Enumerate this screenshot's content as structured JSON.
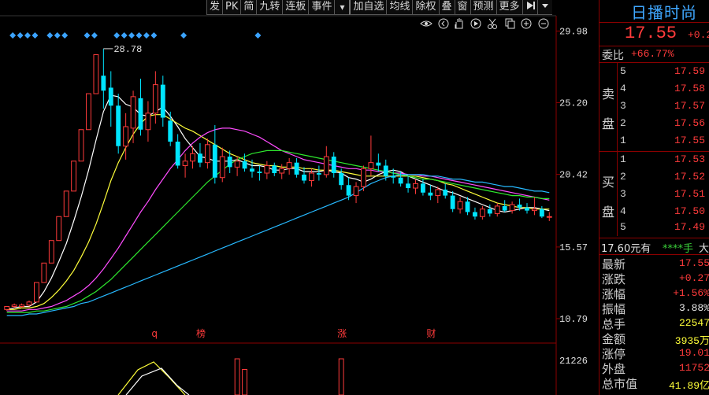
{
  "toolbar": {
    "items": [
      "发",
      "PK",
      "简",
      "九转",
      "连板",
      "事件",
      "▾",
      "加自选",
      "均线",
      "除权",
      "叠",
      "窗",
      "预测",
      "更多"
    ],
    "arrow_icon": "play-arrow-icon",
    "dropdown_icon": "chevron-down-icon"
  },
  "chart_icons": [
    "eye-icon",
    "chevron-left-circle-icon",
    "hand-icon",
    "play-circle-icon",
    "scissors-icon",
    "copy-icon",
    "zoom-in-icon",
    "zoom-out-icon"
  ],
  "price_axis": [
    "29.98",
    "25.20",
    "20.42",
    "15.57",
    "10.79"
  ],
  "volume_axis": [
    "21226"
  ],
  "high_annotation": "28.78",
  "event_markers": [
    {
      "label": "q",
      "bar": 20
    },
    {
      "label": "榜",
      "bar": 26
    },
    {
      "label": "涨",
      "bar": 45
    },
    {
      "label": "财",
      "bar": 57
    }
  ],
  "colors": {
    "up": "#ff3b3b",
    "down": "#00e5ff",
    "ma5": "#ffffff",
    "ma10": "#ffff3a",
    "ma20": "#ff4cff",
    "ma30": "#2ee82e",
    "ma60": "#27b9ff",
    "axis": "#8b0000",
    "diamond": "#3ba3ff"
  },
  "chart_data": {
    "type": "candlestick",
    "ylim": [
      10.0,
      31.0
    ],
    "candles": [
      [
        11.4,
        11.6,
        11.3,
        11.6
      ],
      [
        11.6,
        11.8,
        11.5,
        11.7
      ],
      [
        11.6,
        11.8,
        11.5,
        11.7
      ],
      [
        11.7,
        12.0,
        11.6,
        11.9
      ],
      [
        11.9,
        13.2,
        11.9,
        13.2
      ],
      [
        13.2,
        14.5,
        13.2,
        14.5
      ],
      [
        14.5,
        16.0,
        14.5,
        16.0
      ],
      [
        16.0,
        17.6,
        16.0,
        17.6
      ],
      [
        17.6,
        19.3,
        17.6,
        19.3
      ],
      [
        19.3,
        21.3,
        19.3,
        21.3
      ],
      [
        21.3,
        23.4,
        21.3,
        23.4
      ],
      [
        23.4,
        25.8,
        23.4,
        25.8
      ],
      [
        25.8,
        28.4,
        25.8,
        28.4
      ],
      [
        27.0,
        28.8,
        24.8,
        26.0
      ],
      [
        26.2,
        27.3,
        23.6,
        25.0
      ],
      [
        25.0,
        25.8,
        21.8,
        22.3
      ],
      [
        22.3,
        24.5,
        21.4,
        23.6
      ],
      [
        23.5,
        26.0,
        22.5,
        25.6
      ],
      [
        25.5,
        26.8,
        23.0,
        23.4
      ],
      [
        23.4,
        25.3,
        22.6,
        24.5
      ],
      [
        24.5,
        27.3,
        23.8,
        26.4
      ],
      [
        26.4,
        27.0,
        23.6,
        24.2
      ],
      [
        24.0,
        24.6,
        22.3,
        22.6
      ],
      [
        22.6,
        23.1,
        20.8,
        21.0
      ],
      [
        21.0,
        21.8,
        20.2,
        21.3
      ],
      [
        21.3,
        22.3,
        20.8,
        21.8
      ],
      [
        21.8,
        22.5,
        20.9,
        21.2
      ],
      [
        21.2,
        22.8,
        20.8,
        22.4
      ],
      [
        22.4,
        23.7,
        19.8,
        20.2
      ],
      [
        20.2,
        22.2,
        19.9,
        21.6
      ],
      [
        21.6,
        22.0,
        20.5,
        20.9
      ],
      [
        20.9,
        21.6,
        20.3,
        21.3
      ],
      [
        21.3,
        21.8,
        20.6,
        20.8
      ],
      [
        20.8,
        21.4,
        20.2,
        20.6
      ],
      [
        20.6,
        21.0,
        20.0,
        20.5
      ],
      [
        20.5,
        21.3,
        20.1,
        21.0
      ],
      [
        21.0,
        21.2,
        20.3,
        20.5
      ],
      [
        20.5,
        21.1,
        20.1,
        20.8
      ],
      [
        20.8,
        21.5,
        20.4,
        21.2
      ],
      [
        21.2,
        21.5,
        20.2,
        20.4
      ],
      [
        20.4,
        20.9,
        19.8,
        20.0
      ],
      [
        20.0,
        20.8,
        19.6,
        20.5
      ],
      [
        20.5,
        21.0,
        20.0,
        20.4
      ],
      [
        20.4,
        22.3,
        20.2,
        21.6
      ],
      [
        21.6,
        21.9,
        20.2,
        20.5
      ],
      [
        20.5,
        20.8,
        19.4,
        19.7
      ],
      [
        19.7,
        20.2,
        18.7,
        19.0
      ],
      [
        19.0,
        19.9,
        18.5,
        19.6
      ],
      [
        19.6,
        21.0,
        19.3,
        20.8
      ],
      [
        20.8,
        23.0,
        20.3,
        21.2
      ],
      [
        21.2,
        21.8,
        20.6,
        21.0
      ],
      [
        21.0,
        21.4,
        20.0,
        20.3
      ],
      [
        20.3,
        20.8,
        19.8,
        20.2
      ],
      [
        20.2,
        20.6,
        19.6,
        19.8
      ],
      [
        19.8,
        20.3,
        19.2,
        19.5
      ],
      [
        19.5,
        20.1,
        19.1,
        19.8
      ],
      [
        19.8,
        20.1,
        19.0,
        19.2
      ],
      [
        19.2,
        19.7,
        18.7,
        19.0
      ],
      [
        19.0,
        19.6,
        18.5,
        19.4
      ],
      [
        19.4,
        19.8,
        18.8,
        19.0
      ],
      [
        19.0,
        19.3,
        17.9,
        18.1
      ],
      [
        18.1,
        18.9,
        17.8,
        18.6
      ],
      [
        18.6,
        18.9,
        17.7,
        17.9
      ],
      [
        17.9,
        18.2,
        17.4,
        17.6
      ],
      [
        17.6,
        18.3,
        17.4,
        18.1
      ],
      [
        18.1,
        18.4,
        17.6,
        17.8
      ],
      [
        17.8,
        18.5,
        17.6,
        18.3
      ],
      [
        18.3,
        18.7,
        17.9,
        18.0
      ],
      [
        18.0,
        18.6,
        17.8,
        18.4
      ],
      [
        18.4,
        18.8,
        18.0,
        18.2
      ],
      [
        18.2,
        18.5,
        17.8,
        18.0
      ],
      [
        18.0,
        18.9,
        17.7,
        18.1
      ],
      [
        18.1,
        18.3,
        17.5,
        17.6
      ],
      [
        17.6,
        17.9,
        17.3,
        17.6
      ]
    ],
    "ma": {
      "ma5": [
        11.4,
        11.5,
        11.6,
        11.6,
        11.9,
        12.6,
        13.5,
        14.6,
        15.8,
        17.3,
        18.9,
        20.7,
        22.7,
        24.6,
        25.7,
        25.6,
        25.1,
        24.9,
        24.4,
        24.3,
        24.6,
        24.9,
        24.3,
        23.6,
        22.8,
        22.2,
        21.6,
        21.5,
        21.3,
        21.3,
        21.3,
        21.4,
        21.2,
        21.0,
        21.0,
        20.9,
        20.7,
        20.7,
        20.8,
        20.8,
        20.6,
        20.6,
        20.6,
        20.7,
        20.6,
        20.5,
        20.2,
        20.1,
        19.9,
        20.1,
        20.4,
        20.6,
        20.7,
        20.6,
        20.3,
        20.1,
        19.9,
        19.7,
        19.5,
        19.3,
        19.2,
        19.0,
        18.8,
        18.6,
        18.4,
        18.2,
        18.0,
        17.9,
        18.0,
        18.1,
        18.2,
        18.2,
        18.1,
        18.0
      ],
      "ma10": [
        11.4,
        11.4,
        11.5,
        11.5,
        11.6,
        11.8,
        12.2,
        12.7,
        13.3,
        14.0,
        14.9,
        15.9,
        17.1,
        18.5,
        20.0,
        21.2,
        22.2,
        23.1,
        23.8,
        24.3,
        24.4,
        24.4,
        24.1,
        23.8,
        23.5,
        23.3,
        23.0,
        22.7,
        22.4,
        22.1,
        21.8,
        21.6,
        21.4,
        21.2,
        21.1,
        21.0,
        21.0,
        20.9,
        20.9,
        20.9,
        20.8,
        20.8,
        20.7,
        20.7,
        20.7,
        20.6,
        20.5,
        20.4,
        20.3,
        20.3,
        20.3,
        20.3,
        20.3,
        20.3,
        20.3,
        20.3,
        20.2,
        20.1,
        20.0,
        19.8,
        19.7,
        19.5,
        19.3,
        19.1,
        18.9,
        18.7,
        18.5,
        18.4,
        18.3,
        18.2,
        18.2,
        18.1,
        18.1,
        18.1
      ],
      "ma20": [
        11.3,
        11.3,
        11.3,
        11.4,
        11.4,
        11.5,
        11.6,
        11.8,
        12.0,
        12.3,
        12.6,
        13.0,
        13.5,
        14.1,
        14.8,
        15.5,
        16.3,
        17.1,
        17.9,
        18.6,
        19.4,
        20.1,
        20.8,
        21.4,
        22.0,
        22.5,
        22.9,
        23.2,
        23.4,
        23.5,
        23.5,
        23.4,
        23.3,
        23.1,
        22.9,
        22.6,
        22.3,
        22.0,
        21.8,
        21.6,
        21.4,
        21.3,
        21.2,
        21.1,
        21.0,
        20.9,
        20.8,
        20.8,
        20.7,
        20.7,
        20.6,
        20.6,
        20.5,
        20.5,
        20.4,
        20.4,
        20.3,
        20.3,
        20.2,
        20.1,
        20.0,
        19.9,
        19.8,
        19.7,
        19.6,
        19.5,
        19.4,
        19.3,
        19.2,
        19.1,
        19.0,
        18.9,
        18.8,
        18.7
      ],
      "ma30": [
        11.2,
        11.2,
        11.2,
        11.2,
        11.3,
        11.3,
        11.4,
        11.5,
        11.6,
        11.8,
        12.0,
        12.3,
        12.6,
        13.0,
        13.4,
        13.9,
        14.4,
        14.9,
        15.4,
        15.9,
        16.4,
        16.9,
        17.4,
        17.9,
        18.4,
        18.9,
        19.4,
        19.9,
        20.3,
        20.7,
        21.1,
        21.4,
        21.6,
        21.8,
        21.9,
        22.0,
        22.0,
        22.0,
        21.9,
        21.8,
        21.7,
        21.6,
        21.5,
        21.4,
        21.3,
        21.2,
        21.1,
        21.0,
        20.9,
        20.8,
        20.7,
        20.6,
        20.5,
        20.4,
        20.3,
        20.2,
        20.1,
        20.1,
        20.0,
        19.9,
        19.8,
        19.7,
        19.6,
        19.5,
        19.4,
        19.3,
        19.2,
        19.1,
        19.0,
        19.0,
        18.9,
        18.9,
        18.8,
        18.8
      ],
      "ma60": [
        11.0,
        11.0,
        11.0,
        11.1,
        11.1,
        11.2,
        11.3,
        11.4,
        11.5,
        11.6,
        11.8,
        11.9,
        12.1,
        12.3,
        12.5,
        12.7,
        12.9,
        13.1,
        13.3,
        13.5,
        13.7,
        13.9,
        14.1,
        14.3,
        14.5,
        14.7,
        14.9,
        15.1,
        15.3,
        15.5,
        15.7,
        15.9,
        16.1,
        16.3,
        16.5,
        16.7,
        16.9,
        17.1,
        17.3,
        17.5,
        17.7,
        17.9,
        18.1,
        18.3,
        18.5,
        18.7,
        18.9,
        19.2,
        19.5,
        19.8,
        20.0,
        20.2,
        20.3,
        20.4,
        20.4,
        20.4,
        20.4,
        20.3,
        20.3,
        20.2,
        20.1,
        20.1,
        20.0,
        19.9,
        19.9,
        19.8,
        19.7,
        19.6,
        19.6,
        19.5,
        19.4,
        19.3,
        19.3,
        19.2
      ]
    },
    "volume": [
      {
        "bar": 31,
        "value": 21226
      },
      {
        "bar": 32,
        "value": 15000
      },
      {
        "bar": 45,
        "value": 21226
      }
    ],
    "diamond_bars": [
      1,
      2,
      3,
      4,
      6,
      7,
      8,
      11,
      12,
      15,
      16,
      17,
      18,
      19,
      20,
      24,
      34
    ]
  },
  "panel": {
    "stock_name": "日播时尚",
    "last_price": "17.55",
    "last_change": "+0.2",
    "commission_label": "委比",
    "commission_value": "+66.77%",
    "sell_label_1": "卖",
    "sell_label_2": "盘",
    "buy_label_1": "买",
    "buy_label_2": "盘",
    "sell_levels": [
      {
        "lvl": "5",
        "px": "17.59"
      },
      {
        "lvl": "4",
        "px": "17.58"
      },
      {
        "lvl": "3",
        "px": "17.57"
      },
      {
        "lvl": "2",
        "px": "17.56"
      },
      {
        "lvl": "1",
        "px": "17.55"
      }
    ],
    "buy_levels": [
      {
        "lvl": "1",
        "px": "17.53"
      },
      {
        "lvl": "2",
        "px": "17.52"
      },
      {
        "lvl": "3",
        "px": "17.51"
      },
      {
        "lvl": "4",
        "px": "17.50"
      },
      {
        "lvl": "5",
        "px": "17.49"
      }
    ],
    "quote_a": "17.60元有",
    "quote_b": "****手",
    "quote_c": "大",
    "stats": [
      {
        "k": "最新",
        "v": "17.55",
        "color": "#ff3b3b"
      },
      {
        "k": "涨跌",
        "v": "+0.27",
        "color": "#ff3b3b"
      },
      {
        "k": "涨幅",
        "v": "+1.56%",
        "color": "#ff3b3b"
      },
      {
        "k": "振幅",
        "v": "3.88%",
        "color": "#e8e8e8"
      },
      {
        "k": "总手",
        "v": "22547",
        "color": "#ffff3a"
      },
      {
        "k": "金额",
        "v": "3935万",
        "color": "#ffff3a"
      },
      {
        "k": "涨停",
        "v": "19.01",
        "color": "#ff3b3b"
      },
      {
        "k": "外盘",
        "v": "11752",
        "color": "#ff3b3b"
      },
      {
        "k": "总市值",
        "v": "41.89亿",
        "color": "#ffff3a"
      }
    ]
  }
}
